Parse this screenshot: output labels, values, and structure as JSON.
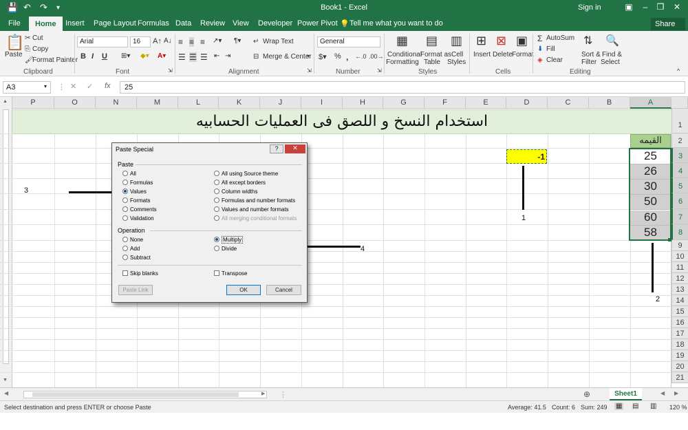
{
  "titlebar": {
    "title": "Book1 - Excel",
    "signin": "Sign in"
  },
  "tabs": [
    "File",
    "Home",
    "Insert",
    "Page Layout",
    "Formulas",
    "Data",
    "Review",
    "View",
    "Developer",
    "Power Pivot"
  ],
  "tell_me": "Tell me what you want to do",
  "share": "Share",
  "ribbon": {
    "clipboard": {
      "label": "Clipboard",
      "paste": "Paste",
      "cut": "Cut",
      "copy": "Copy",
      "format_painter": "Format Painter"
    },
    "font": {
      "label": "Font",
      "name": "Arial",
      "size": "16",
      "bold": "B",
      "italic": "I",
      "underline": "U"
    },
    "alignment": {
      "label": "Alignment",
      "wrap_text": "Wrap Text",
      "merge_center": "Merge & Center"
    },
    "number": {
      "label": "Number",
      "format": "General",
      "percent": "%",
      "comma": ","
    },
    "styles": {
      "label": "Styles",
      "conditional": "Conditional",
      "formatting": "Formatting",
      "format_as": "Format as",
      "table": "Table",
      "cell": "Cell",
      "styles_label": "Styles"
    },
    "cells": {
      "label": "Cells",
      "insert": "Insert",
      "delete": "Delete",
      "format": "Format"
    },
    "editing": {
      "label": "Editing",
      "autosum": "AutoSum",
      "fill": "Fill",
      "clear": "Clear",
      "sort": "Sort &",
      "filter": "Filter",
      "find": "Find &",
      "select": "Select"
    }
  },
  "formula_bar": {
    "name_box": "A3",
    "fx": "fx",
    "content": "25"
  },
  "columns": [
    "P",
    "O",
    "N",
    "M",
    "L",
    "K",
    "J",
    "I",
    "H",
    "G",
    "F",
    "E",
    "D",
    "C",
    "B",
    "A"
  ],
  "rows": [
    "1",
    "2",
    "3",
    "4",
    "5",
    "6",
    "7",
    "8",
    "9",
    "10",
    "11",
    "12",
    "13",
    "14",
    "15",
    "16",
    "17",
    "18",
    "19",
    "20",
    "21"
  ],
  "sheet": {
    "title": "استخدام النسخ و اللصق فى العمليات الحسابيه",
    "header": "القيمه",
    "values": [
      "25",
      "26",
      "30",
      "50",
      "60",
      "58"
    ],
    "multiplier": "-1"
  },
  "annotations": [
    "1",
    "2",
    "3",
    "4"
  ],
  "dialog": {
    "title": "Paste Special",
    "paste_section": "Paste",
    "paste_left": [
      "All",
      "Formulas",
      "Values",
      "Formats",
      "Comments",
      "Validation"
    ],
    "paste_right": [
      "All using Source theme",
      "All except borders",
      "Column widths",
      "Formulas and number formats",
      "Values and number formats",
      "All merging conditional formats"
    ],
    "operation_section": "Operation",
    "op_left": [
      "None",
      "Add",
      "Subtract"
    ],
    "op_right": [
      "Multiply",
      "Divide"
    ],
    "skip_blanks": "Skip blanks",
    "transpose": "Transpose",
    "paste_link": "Paste Link",
    "ok": "OK",
    "cancel": "Cancel",
    "help": "?",
    "close": "✕"
  },
  "sheet_tab": "Sheet1",
  "status": {
    "message": "Select destination and press ENTER or choose Paste",
    "average": "Average: 41.5",
    "count": "Count: 6",
    "sum": "Sum: 249",
    "zoom": "120 %"
  },
  "colors": {
    "excel_green": "#217346",
    "title_fill": "#e2efda",
    "header_fill": "#a9d08e",
    "highlight": "#ffff00"
  }
}
